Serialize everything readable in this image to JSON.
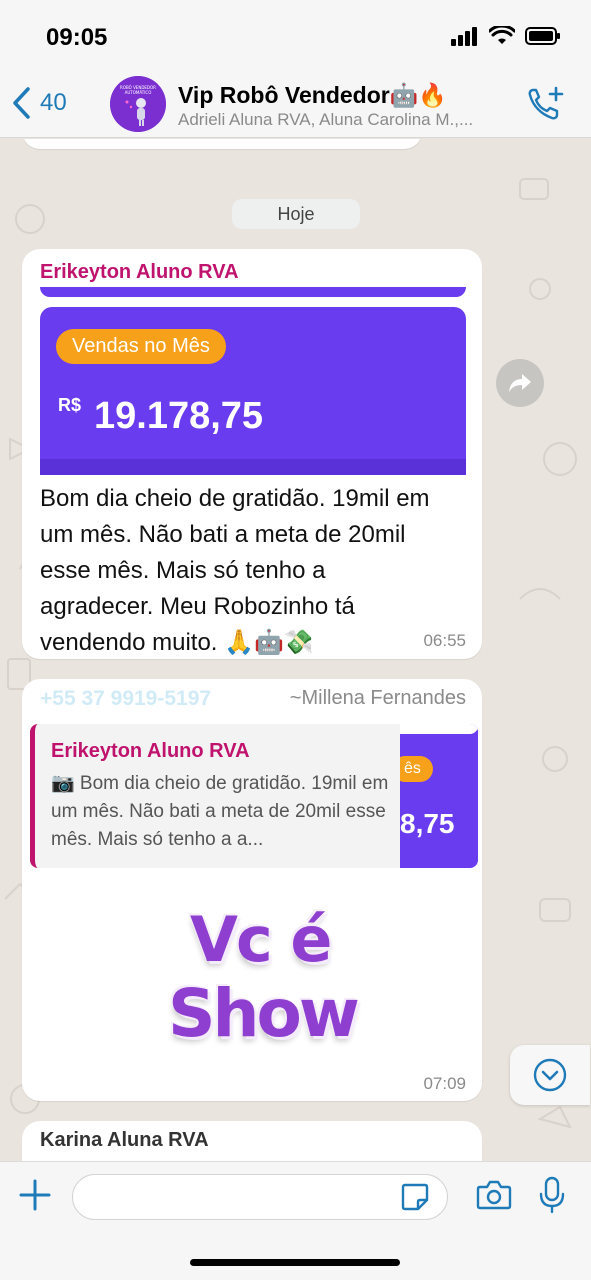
{
  "status_bar": {
    "time": "09:05"
  },
  "header": {
    "back_count": "40",
    "group_name": "Vip Robô Vendedor🤖🔥",
    "members": "Adrieli Aluna RVA, Aluna Carolina M.,...",
    "avatar_text": "ROBÔ VENDEDOR AUTOMÁTICO"
  },
  "chat": {
    "date_label": "Hoje",
    "messages": [
      {
        "sender": "Erikeyton Aluno RVA",
        "image": {
          "chip_label": "Vendas no Mês",
          "currency": "R$",
          "amount": "19.178,75"
        },
        "lines": [
          "Bom dia cheio de gratidão. 19mil em",
          "um mês. Não bati a meta de 20mil",
          "esse mês. Mais só tenho a",
          "agradecer. Meu Robozinho tá",
          "vendendo muito. 🙏🤖💸"
        ],
        "time": "06:55"
      },
      {
        "sender_phone": "+55 37 9919-5197",
        "sender_name": "~Millena Fernandes",
        "quote": {
          "sender": "Erikeyton Aluno RVA",
          "text": "📷 Bom dia cheio de gratidão. 19mil em um mês. Não bati a meta de 20mil esse mês. Mais só tenho a a...",
          "thumb_chip": "ês",
          "thumb_amount": "8,75"
        },
        "sticker_line1": "Vc é",
        "sticker_line2": "Show",
        "time": "07:09"
      },
      {
        "sender": "Karina Aluna RVA"
      }
    ]
  },
  "colors": {
    "accent_blue": "#1f7ab8",
    "sender_pink": "#c0136e",
    "promo_purple": "#6a3cf0",
    "chip_orange": "#f7a019",
    "sticker_purple": "#8e3fcf"
  },
  "icons": {
    "back": "chevron-left-icon",
    "call": "add-call-icon",
    "forward": "forward-icon",
    "scroll_down": "chevron-down-icon",
    "attach": "plus-icon",
    "sticker": "sticker-icon",
    "camera": "camera-icon",
    "mic": "microphone-icon"
  }
}
